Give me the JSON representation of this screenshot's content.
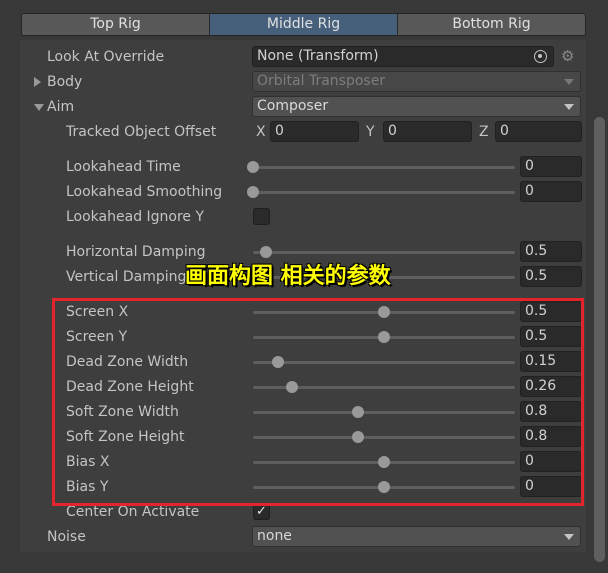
{
  "tabs": [
    {
      "label": "Top Rig",
      "active": false
    },
    {
      "label": "Middle Rig",
      "active": true
    },
    {
      "label": "Bottom Rig",
      "active": false
    }
  ],
  "look_at": {
    "label": "Look At Override",
    "value": "None (Transform)",
    "target_icon": "object-picker-icon",
    "settings_icon": "gear-icon"
  },
  "body": {
    "label": "Body",
    "value": "Orbital Transposer",
    "expanded": false,
    "disabled": true
  },
  "aim": {
    "label": "Aim",
    "value": "Composer",
    "expanded": true
  },
  "tracked_offset": {
    "label": "Tracked Object Offset",
    "x_label": "X",
    "x": "0",
    "y_label": "Y",
    "y": "0",
    "z_label": "Z",
    "z": "0"
  },
  "lookahead_time": {
    "label": "Lookahead Time",
    "value": "0",
    "level": 0
  },
  "lookahead_smoothing": {
    "label": "Lookahead Smoothing",
    "value": "0",
    "level": 0
  },
  "lookahead_ignore_y": {
    "label": "Lookahead Ignore Y",
    "checked": false
  },
  "horizontal_damping": {
    "label": "Horizontal Damping",
    "value": "0.5",
    "level": 0.05
  },
  "vertical_damping": {
    "label": "Vertical Damping",
    "value": "0.5",
    "level": 0.05
  },
  "composition": [
    {
      "label": "Screen X",
      "value": "0.5",
      "level": 0.5
    },
    {
      "label": "Screen Y",
      "value": "0.5",
      "level": 0.5
    },
    {
      "label": "Dead Zone Width",
      "value": "0.15",
      "level": 0.096
    },
    {
      "label": "Dead Zone Height",
      "value": "0.26",
      "level": 0.149
    },
    {
      "label": "Soft Zone Width",
      "value": "0.8",
      "level": 0.4
    },
    {
      "label": "Soft Zone Height",
      "value": "0.8",
      "level": 0.4
    },
    {
      "label": "Bias X",
      "value": "0",
      "level": 0.5
    },
    {
      "label": "Bias Y",
      "value": "0",
      "level": 0.5
    }
  ],
  "center_on_activate": {
    "label": "Center On Activate",
    "checked": true,
    "check": "✓"
  },
  "noise": {
    "label": "Noise",
    "value": "none"
  },
  "annotation": {
    "text": "画面构图 相关的参数",
    "color": "#ffff00",
    "box_color": "#e3242b"
  },
  "colors": {
    "active_tab": "#46607c",
    "background": "#383838"
  }
}
